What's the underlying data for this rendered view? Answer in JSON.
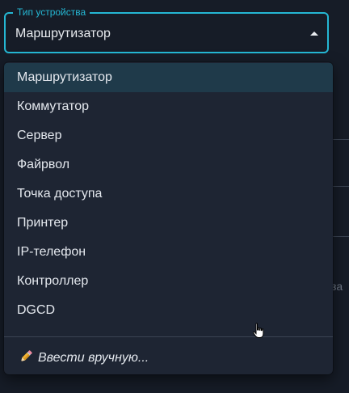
{
  "select": {
    "label": "Тип устройства",
    "value": "Маршрутизатор"
  },
  "menu": {
    "options": [
      "Маршрутизатор",
      "Коммутатор",
      "Сервер",
      "Файрвол",
      "Точка доступа",
      "Принтер",
      "IP-телефон",
      "Контроллер",
      "DGCD"
    ],
    "selected_index": 0,
    "manual_entry": "Ввести вручную...",
    "manual_icon": "pencil-icon"
  },
  "background": {
    "partial_text": "за"
  },
  "colors": {
    "accent": "#25b7d3",
    "menu_background": "#1e2533",
    "selected_background": "#1f3a4a",
    "page_background": "#161c27"
  }
}
